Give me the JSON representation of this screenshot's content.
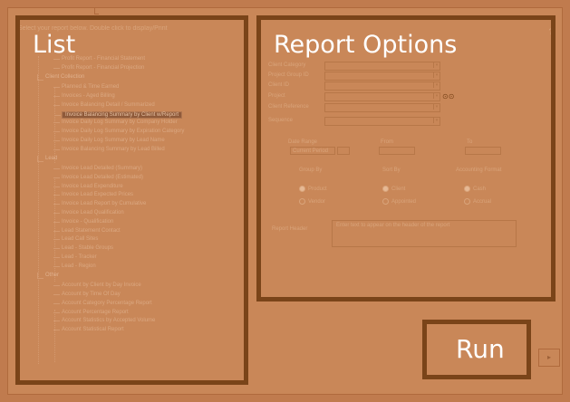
{
  "window": {
    "close_glyph": "?"
  },
  "panels": {
    "list_title": "List",
    "options_title": "Report Options",
    "run_title": "Run"
  },
  "list": {
    "header": "Select your report below. Double click to display/Print",
    "items": [
      {
        "label": "Profit Report - Financial Statement",
        "type": "leaf"
      },
      {
        "label": "Profit Report - Financial Projection",
        "type": "leaf"
      },
      {
        "label": "Client Collection",
        "type": "folder"
      },
      {
        "label": "Planned & Time Earned",
        "type": "leaf"
      },
      {
        "label": "Invoices - Aged Billing",
        "type": "leaf"
      },
      {
        "label": "Invoice Balancing Detail / Summarized",
        "type": "leaf"
      },
      {
        "label": "Invoice Balancing Summary by Client w/Report",
        "type": "leaf",
        "selected": true
      },
      {
        "label": "Invoice Daily Log Summary by Company Holder",
        "type": "leaf"
      },
      {
        "label": "Invoice Daily Log Summary by Expiration Category",
        "type": "leaf"
      },
      {
        "label": "Invoice Daily Log Summary by Lead Name",
        "type": "leaf"
      },
      {
        "label": "Invoice Balancing Summary by Lead Billed",
        "type": "leaf"
      },
      {
        "label": "Lead",
        "type": "folder"
      },
      {
        "label": "Invoice Lead Detailed (Summary)",
        "type": "leaf"
      },
      {
        "label": "Invoice Lead Detailed (Estimated)",
        "type": "leaf"
      },
      {
        "label": "Invoice Lead Expenditure",
        "type": "leaf"
      },
      {
        "label": "Invoice Lead Expected Prices",
        "type": "leaf"
      },
      {
        "label": "Invoice Lead Report by Cumulative",
        "type": "leaf"
      },
      {
        "label": "Invoice Lead Qualification",
        "type": "leaf"
      },
      {
        "label": "Invoice - Qualification",
        "type": "leaf"
      },
      {
        "label": "Lead Statement Contact",
        "type": "leaf"
      },
      {
        "label": "Lead Call Sites",
        "type": "leaf"
      },
      {
        "label": "Lead - Stable Groups",
        "type": "leaf"
      },
      {
        "label": "Lead - Tracker",
        "type": "leaf"
      },
      {
        "label": "Lead - Region",
        "type": "leaf"
      },
      {
        "label": "Other",
        "type": "folder"
      },
      {
        "label": "Account by Client by Day Invoice",
        "type": "leaf"
      },
      {
        "label": "Account by Time Of Day",
        "type": "leaf"
      },
      {
        "label": "Account Category Percentage Report",
        "type": "leaf"
      },
      {
        "label": "Account Percentage Report",
        "type": "leaf"
      },
      {
        "label": "Account Statistics by Accepted Volume",
        "type": "leaf"
      },
      {
        "label": "Account Statistical Report",
        "type": "leaf"
      }
    ]
  },
  "options": {
    "fields": [
      {
        "label": "Client Category",
        "value": ""
      },
      {
        "label": "Project Group ID",
        "value": ""
      },
      {
        "label": "Client ID",
        "value": ""
      },
      {
        "label": "Project",
        "value": ""
      },
      {
        "label": "Client Reference",
        "value": ""
      },
      {
        "label": "Sequence",
        "value": ""
      }
    ],
    "date_range_label": "Date Range",
    "date_range_value": "Current Period",
    "from_label": "From",
    "to_label": "To",
    "group_label": "Group By",
    "sort_label": "Sort By",
    "format_label": "Accounting Format",
    "radios": [
      {
        "label": "Product",
        "checked": true
      },
      {
        "label": "Vendor",
        "checked": false
      },
      {
        "label": "Client",
        "checked": true
      },
      {
        "label": "Appointed",
        "checked": false
      },
      {
        "label": "Cash",
        "checked": true
      },
      {
        "label": "Accrual",
        "checked": false
      }
    ],
    "comment_label": "Report Header",
    "comment_value": "Enter text to appear on the header of the report"
  },
  "buttons": {
    "next_glyph": "▸"
  }
}
